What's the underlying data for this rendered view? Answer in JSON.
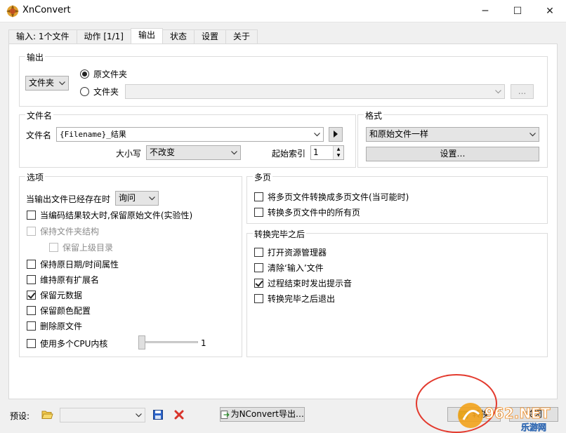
{
  "window": {
    "title": "XnConvert",
    "minimize": "─",
    "maximize": "☐",
    "close": "✕"
  },
  "tabs": [
    {
      "label": "输入: 1个文件"
    },
    {
      "label": "动作 [1/1]"
    },
    {
      "label": "输出"
    },
    {
      "label": "状态"
    },
    {
      "label": "设置"
    },
    {
      "label": "关于"
    }
  ],
  "output_group": {
    "title": "输出",
    "destination_combo": "文件夹",
    "radio_original": "原文件夹",
    "radio_folder": "文件夹",
    "folder_path": "",
    "browse_label": "..."
  },
  "filename_group": {
    "title": "文件名",
    "filename_label": "文件名",
    "filename_value": "{Filename}_结果",
    "case_label": "大小写",
    "case_value": "不改变",
    "start_index_label": "起始索引",
    "start_index_value": "1"
  },
  "format_group": {
    "title": "格式",
    "format_value": "和原始文件一样",
    "settings_label": "设置…"
  },
  "options_group": {
    "title": "选项",
    "if_exists_label": "当输出文件已经存在时",
    "if_exists_value": "询问",
    "options": [
      {
        "label": "当编码结果较大时,保留原始文件(实验性)",
        "checked": false,
        "disabled": false
      },
      {
        "label": "保持文件夹结构",
        "checked": false,
        "disabled": true
      },
      {
        "label": "保留上级目录",
        "checked": false,
        "disabled": true
      },
      {
        "label": "保持原日期/时间属性",
        "checked": false,
        "disabled": false
      },
      {
        "label": "维持原有扩展名",
        "checked": false,
        "disabled": false
      },
      {
        "label": "保留元数据",
        "checked": true,
        "disabled": false
      },
      {
        "label": "保留颜色配置",
        "checked": false,
        "disabled": false
      },
      {
        "label": "删除原文件",
        "checked": false,
        "disabled": false
      },
      {
        "label": "使用多个CPU内核",
        "checked": false,
        "disabled": false
      }
    ],
    "cpu_value": "1"
  },
  "multipage_group": {
    "title": "多页",
    "options": [
      {
        "label": "将多页文件转换成多页文件(当可能时)",
        "checked": false
      },
      {
        "label": "转换多页文件中的所有页",
        "checked": false
      }
    ]
  },
  "after_group": {
    "title": "转换完毕之后",
    "options": [
      {
        "label": "打开资源管理器",
        "checked": false
      },
      {
        "label": "清除‘输入’文件",
        "checked": false
      },
      {
        "label": "过程结束时发出提示音",
        "checked": true
      },
      {
        "label": "转换完毕之后退出",
        "checked": false
      }
    ]
  },
  "bottom": {
    "preset_label": "预设:",
    "preset_value": "",
    "export_label": "为NConvert导出…",
    "convert_label": "转换",
    "close_label": "关闭"
  },
  "watermark": {
    "brand": "962.NET",
    "sub": "乐游网"
  },
  "colors": {
    "annotation_circle": "#e33a2e",
    "delete_icon": "#d9342b",
    "save_icon": "#2b63c9"
  }
}
